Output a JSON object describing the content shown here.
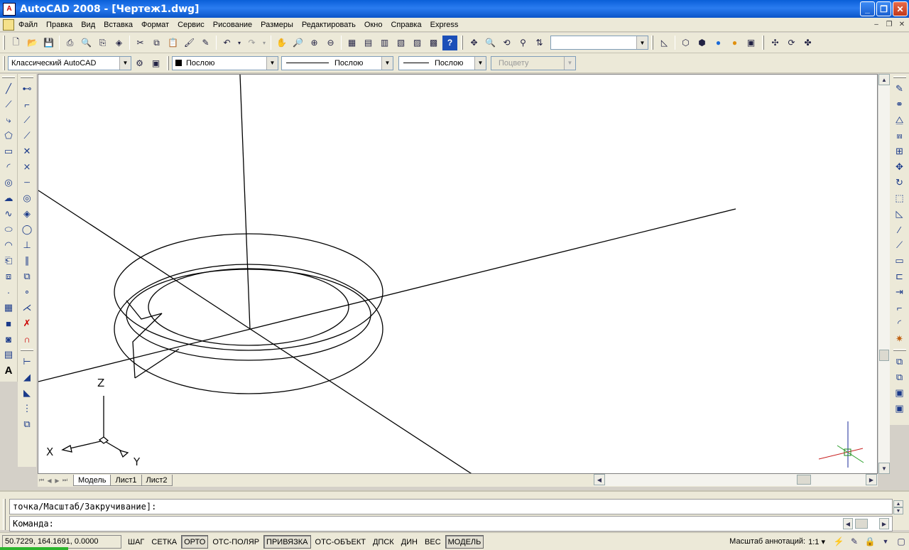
{
  "window": {
    "title": "AutoCAD 2008 - [Чертеж1.dwg]",
    "app_icon": "A",
    "minimize": "_",
    "restore": "❐",
    "close": "✕"
  },
  "menu": {
    "items": [
      "Файл",
      "Правка",
      "Вид",
      "Вставка",
      "Формат",
      "Сервис",
      "Рисование",
      "Размеры",
      "Редактировать",
      "Окно",
      "Справка",
      "Express"
    ]
  },
  "toolbar_properties": {
    "workspace": "Классический AutoCAD",
    "color": "Послою",
    "linetype": "Послою",
    "lineweight": "Послою",
    "plotstyle": "Поцвету"
  },
  "toolbar_standard": {
    "view_combo": ""
  },
  "viewport": {
    "ucs_labels": {
      "z": "Z",
      "x": "X",
      "y": "Y"
    }
  },
  "layout_tabs": [
    "Модель",
    "Лист1",
    "Лист2"
  ],
  "command": {
    "history": "точка/Масштаб/Закручивание]:",
    "prompt": "Команда:"
  },
  "status": {
    "coords": "50.7229, 164.1691, 0.0000",
    "buttons": [
      {
        "label": "ШАГ",
        "on": false
      },
      {
        "label": "СЕТКА",
        "on": false
      },
      {
        "label": "ОРТО",
        "on": true
      },
      {
        "label": "ОТС-ПОЛЯР",
        "on": false
      },
      {
        "label": "ПРИВЯЗКА",
        "on": true
      },
      {
        "label": "ОТС-ОБЪЕКТ",
        "on": false
      },
      {
        "label": "ДПСК",
        "on": false
      },
      {
        "label": "ДИН",
        "on": false
      },
      {
        "label": "ВЕС",
        "on": false
      },
      {
        "label": "МОДЕЛЬ",
        "on": true
      }
    ],
    "annotation_scale_label": "Масштаб аннотаций:",
    "annotation_scale": "1:1 ▾"
  }
}
